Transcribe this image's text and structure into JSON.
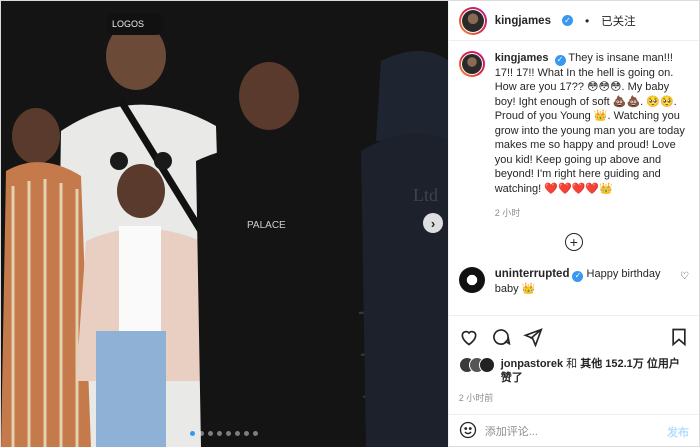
{
  "post": {
    "username": "kingjames",
    "follow_label": "已关注",
    "separator": "•",
    "verified_glyph": "✓"
  },
  "caption": {
    "username": "kingjames",
    "text": "They is insane man!!! 17!! 17!! What In the hell is going on. How are you 17?? 😳😳😳. My baby boy! Ight enough of soft 💩💩. 🥺🥺. Proud of you Young 👑. Watching you grow into the young man you are today makes me so happy and proud! Love you kid! Keep going up above and beyond! I'm right here guiding and watching! ❤️❤️❤️❤️👑",
    "time": "2 小时"
  },
  "comments": [
    {
      "username": "uninterrupted",
      "text": "Happy birthday baby 👑",
      "verified": true
    }
  ],
  "likes": {
    "first_user": "jonpastorek",
    "text_mid": " 和 ",
    "others_label": "其他 152.1万 位用户",
    "text_end": "赞了"
  },
  "post_time": "2 小时前",
  "comment_input": {
    "placeholder": "添加评论...",
    "post_label": "发布"
  },
  "photo": {
    "shirt_text": "PALACE",
    "hat_text": "LOGOS",
    "hoodie_text": "Ltd",
    "carousel_dots": 8,
    "active_dot": 0,
    "next_glyph": "›"
  },
  "icons": {
    "heart": "heart-icon",
    "comment": "comment-icon",
    "share": "share-icon",
    "bookmark": "bookmark-icon",
    "plus": "plus-circle-icon",
    "emoji": "emoji-icon"
  },
  "colors": {
    "accent": "#3897f0",
    "text": "#262626",
    "muted": "#8e8e8e",
    "post_disabled": "#b2dffc"
  }
}
